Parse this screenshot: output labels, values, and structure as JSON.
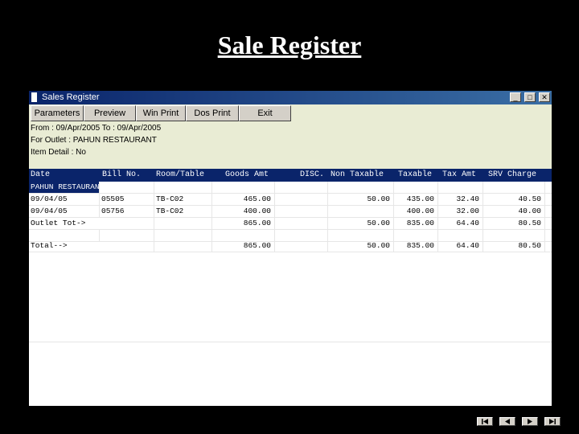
{
  "slide": {
    "title": "Sale Register"
  },
  "window": {
    "title": "Sales Register",
    "controls": [
      "minimize-icon",
      "maximize-icon",
      "close-icon"
    ]
  },
  "toolbar": {
    "buttons": [
      "Parameters",
      "Preview",
      "Win Print",
      "Dos Print",
      "Exit"
    ]
  },
  "info": {
    "from_line": "From : 09/Apr/2005 To : 09/Apr/2005",
    "outlet_line": "For Outlet : PAHUN RESTAURANT",
    "item_line": "Item Detail : No"
  },
  "table": {
    "columns": [
      "Date",
      "Bill No.",
      "Room/Table",
      "Goods Amt",
      "DISC.",
      "Non Taxable",
      "Taxable",
      "Tax Amt",
      "SRV Charge"
    ],
    "outlet_row": "PAHUN RESTAURANT",
    "rows": [
      [
        "09/04/05",
        "05505",
        "TB-C02",
        "465.00",
        "",
        "50.00",
        "435.00",
        "32.40",
        "40.50"
      ],
      [
        "09/04/05",
        "05756",
        "TB-C02",
        "400.00",
        "",
        "",
        "400.00",
        "32.00",
        "40.00"
      ]
    ],
    "outlet_total": [
      "Outlet Tot->",
      "",
      "",
      "865.00",
      "",
      "50.00",
      "835.00",
      "64.40",
      "80.50"
    ],
    "grand_total": [
      "Total-->",
      "",
      "",
      "865.00",
      "",
      "50.00",
      "835.00",
      "64.40",
      "80.50"
    ]
  },
  "nav": [
    "first-icon",
    "prev-icon",
    "next-icon",
    "last-icon"
  ]
}
